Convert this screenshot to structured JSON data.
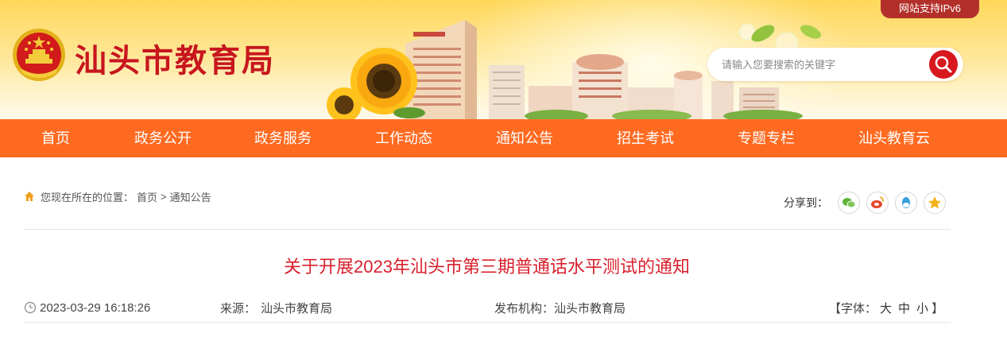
{
  "header": {
    "site_title": "汕头市教育局",
    "ipv6_badge": "网站支持IPv6",
    "search": {
      "placeholder": "请输入您要搜索的关键字",
      "value": ""
    },
    "icons": {
      "emblem": "national-emblem-icon",
      "search": "search-icon"
    }
  },
  "nav": {
    "items": [
      {
        "label": "首页"
      },
      {
        "label": "政务公开"
      },
      {
        "label": "政务服务"
      },
      {
        "label": "工作动态"
      },
      {
        "label": "通知公告"
      },
      {
        "label": "招生考试"
      },
      {
        "label": "专题专栏"
      },
      {
        "label": "汕头教育云"
      }
    ]
  },
  "breadcrumb": {
    "prefix": "您现在所在的位置：",
    "home": "首页",
    "separator": ">",
    "current": "通知公告",
    "icon": "home-icon"
  },
  "share": {
    "label": "分享到：",
    "targets": [
      {
        "name": "wechat-icon"
      },
      {
        "name": "weibo-icon"
      },
      {
        "name": "qq-icon"
      },
      {
        "name": "favorite-star-icon"
      }
    ]
  },
  "article": {
    "title": "关于开展2023年汕头市第三期普通话水平测试的通知",
    "datetime": "2023-03-29 16:18:26",
    "source_label": "来源：",
    "source": "汕头市教育局",
    "publisher_label": "发布机构：",
    "publisher": "汕头市教育局",
    "font_label": "【字体：",
    "font_large": "大",
    "font_medium": "中",
    "font_small": "小",
    "font_close": "】"
  },
  "colors": {
    "nav_bg": "#ff6a21",
    "title_red": "#d8202c",
    "brand_red": "#c8161d",
    "badge_bg": "#b3302a"
  }
}
